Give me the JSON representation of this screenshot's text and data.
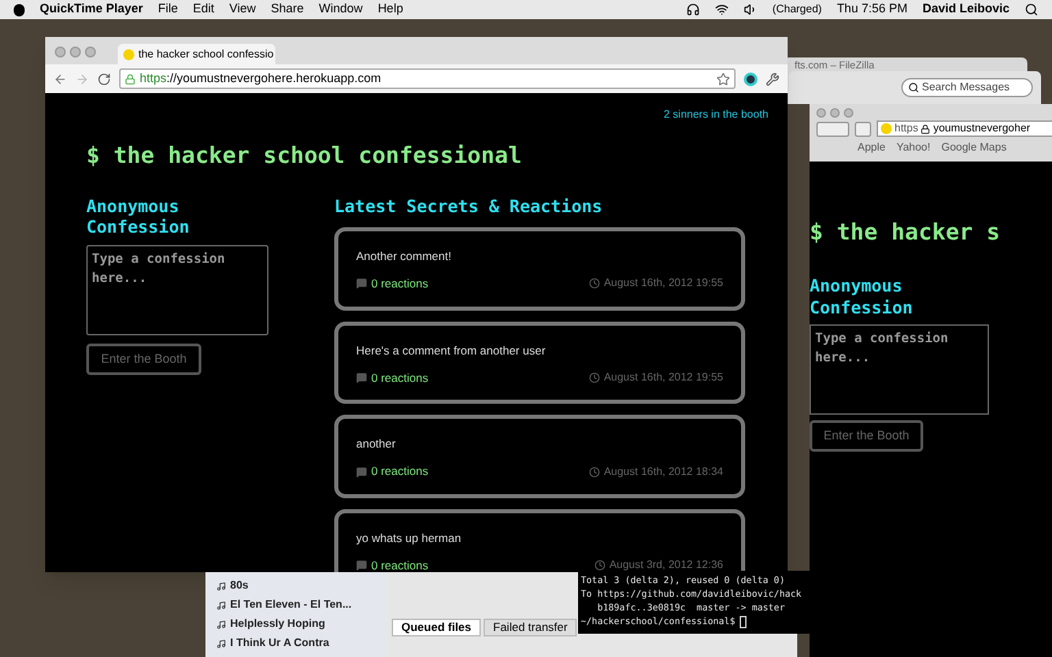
{
  "menu_bar": {
    "app": "QuickTime Player",
    "menus": [
      "File",
      "Edit",
      "View",
      "Share",
      "Window",
      "Help"
    ],
    "battery": "(Charged)",
    "clock": "Thu 7:56 PM",
    "user": "David Leibovic"
  },
  "chrome_window": {
    "tab_title": "the hacker school confessio",
    "url_scheme": "https",
    "url_rest": "://youmustnevergohere.herokuapp.com"
  },
  "page": {
    "sinners": "2 sinners in the booth",
    "title": "$ the hacker school confessional",
    "left_heading": "Anonymous Confession",
    "confession_placeholder": "Type a confession here...",
    "submit": "Enter the Booth",
    "right_heading": "Latest Secrets & Reactions",
    "secrets": [
      {
        "text": "Another comment!",
        "reactions": "0 reactions",
        "date": "August 16th, 2012 19:55"
      },
      {
        "text": "Here's a comment from another user",
        "reactions": "0 reactions",
        "date": "August 16th, 2012 19:55"
      },
      {
        "text": "another",
        "reactions": "0 reactions",
        "date": "August 16th, 2012 18:34"
      },
      {
        "text": "yo whats up herman",
        "reactions": "0 reactions",
        "date": "August 3rd, 2012 12:36"
      }
    ]
  },
  "filezilla_title": "fts.com – FileZilla",
  "mail": {
    "search_placeholder": "Search Messages"
  },
  "safari_window": {
    "url_scheme": "https",
    "url_rest": "youmustnevergoher",
    "bookmarks": [
      "Apple",
      "Yahoo!",
      "Google Maps"
    ],
    "title": "$ the hacker s",
    "heading": "Anonymous Confession",
    "confession_placeholder": "Type a confession here...",
    "submit": "Enter the Booth"
  },
  "playlist": [
    "80s",
    "El Ten Eleven - El Ten...",
    "Helplessly Hoping",
    "I Think Ur A Contra"
  ],
  "transfer_tabs": [
    {
      "label": "Queued files",
      "selected": true
    },
    {
      "label": "Failed transfer",
      "selected": false
    }
  ],
  "terminal": {
    "lines": [
      "Total 3 (delta 2), reused 0 (delta 0)",
      "To https://github.com/davidleibovic/hack",
      "   b189afc..3e0819c  master -> master"
    ],
    "prompt": "~/hackerschool/confessional$"
  }
}
